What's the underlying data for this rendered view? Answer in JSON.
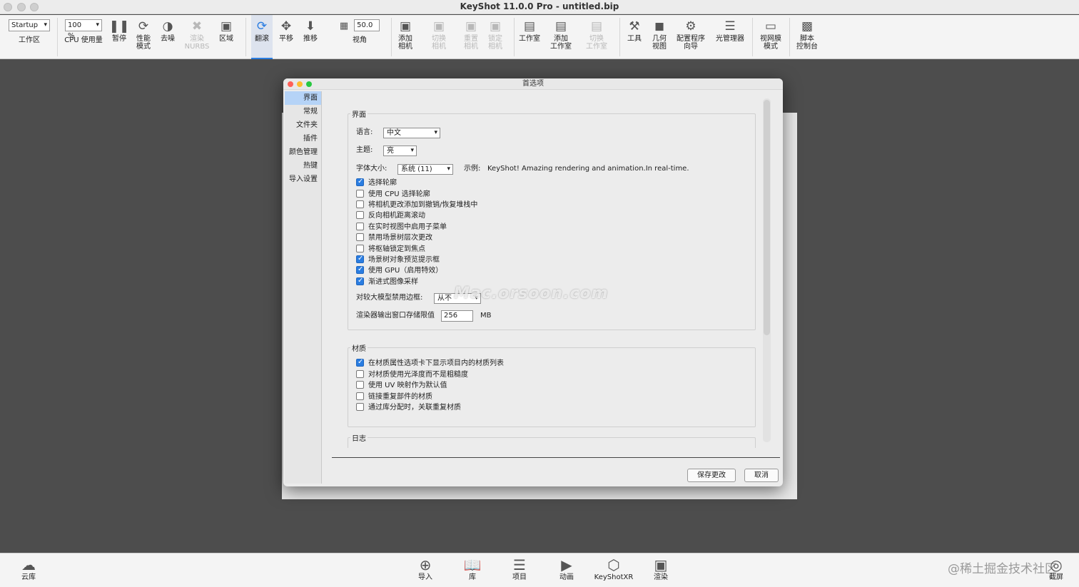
{
  "window": {
    "title": "KeyShot 11.0.0 Pro  - untitled.bip"
  },
  "toolbar": {
    "workspace_value": "Startup",
    "workspace_label": "工作区",
    "cpu_value": "100 %",
    "cpu_label": "CPU 使用量",
    "pause": "暂停",
    "performance": "性能\n模式",
    "denoise": "去噪",
    "nurbs": "渲染\nNURBS",
    "region": "区域",
    "tumble": "翻滚",
    "pan": "平移",
    "dolly": "推移",
    "fov_value": "50.0",
    "fov_label": "视角",
    "add_camera": "添加\n相机",
    "switch_camera": "切换\n相机",
    "reset_camera": "重置\n相机",
    "lock_camera": "锁定\n相机",
    "studio": "工作室",
    "add_studio": "添加\n工作室",
    "switch_studio": "切换\n工作室",
    "tools": "工具",
    "geometry_view": "几何\n视图",
    "configurator": "配置程序\n向导",
    "light_manager": "光管理器",
    "web_mode": "视网膜\n模式",
    "script_console": "脚本\n控制台"
  },
  "dialog": {
    "title": "首选项",
    "nav": [
      "界面",
      "常规",
      "文件夹",
      "插件",
      "颜色管理",
      "热键",
      "导入设置"
    ],
    "interface_group": "界面",
    "language_label": "语言:",
    "language_value": "中文",
    "theme_label": "主题:",
    "theme_value": "亮",
    "font_size_label": "字体大小:",
    "font_size_value": "系统 (11)",
    "example_label": "示例:",
    "example_text": "KeyShot! Amazing rendering and animation.In real-time.",
    "options": [
      {
        "label": "选择轮廓",
        "checked": true
      },
      {
        "label": "使用 CPU 选择轮廓",
        "checked": false
      },
      {
        "label": "将相机更改添加到撤销/恢复堆栈中",
        "checked": false
      },
      {
        "label": "反向相机距离滚动",
        "checked": false
      },
      {
        "label": "在实时视图中启用子菜单",
        "checked": false
      },
      {
        "label": "禁用场景树层次更改",
        "checked": false
      },
      {
        "label": "将枢轴锁定到焦点",
        "checked": false
      },
      {
        "label": "场景树对象预览提示框",
        "checked": true
      },
      {
        "label": "使用 GPU（启用特效）",
        "checked": true
      },
      {
        "label": "渐进式图像采样",
        "checked": true
      }
    ],
    "large_model_label": "对较大模型禁用边框:",
    "large_model_value": "从不",
    "render_buffer_label": "渲染器输出窗口存储限值",
    "render_buffer_value": "256",
    "render_buffer_unit": "MB",
    "material_group": "材质",
    "material_options": [
      {
        "label": "在材质属性选项卡下显示项目内的材质列表",
        "checked": true
      },
      {
        "label": "对材质使用光泽度而不是粗糙度",
        "checked": false
      },
      {
        "label": "使用 UV 映射作为默认值",
        "checked": false
      },
      {
        "label": "链接重复部件的材质",
        "checked": false
      },
      {
        "label": "通过库分配时，关联重复材质",
        "checked": false
      }
    ],
    "log_group": "日志",
    "save_button": "保存更改",
    "cancel_button": "取消"
  },
  "watermark": "Mac.orsoon.com",
  "bottombar": {
    "cloud": "云库",
    "import": "导入",
    "library": "库",
    "project": "项目",
    "animation": "动画",
    "keyshotxr": "KeyShotXR",
    "render": "渲染",
    "screenshot": "截屏",
    "juejin": "@稀土掘金技术社区"
  },
  "colors": {
    "accent": "#2a7de1",
    "viewport": "#4d4d4d",
    "nav_selected": "#b5d3f7"
  }
}
